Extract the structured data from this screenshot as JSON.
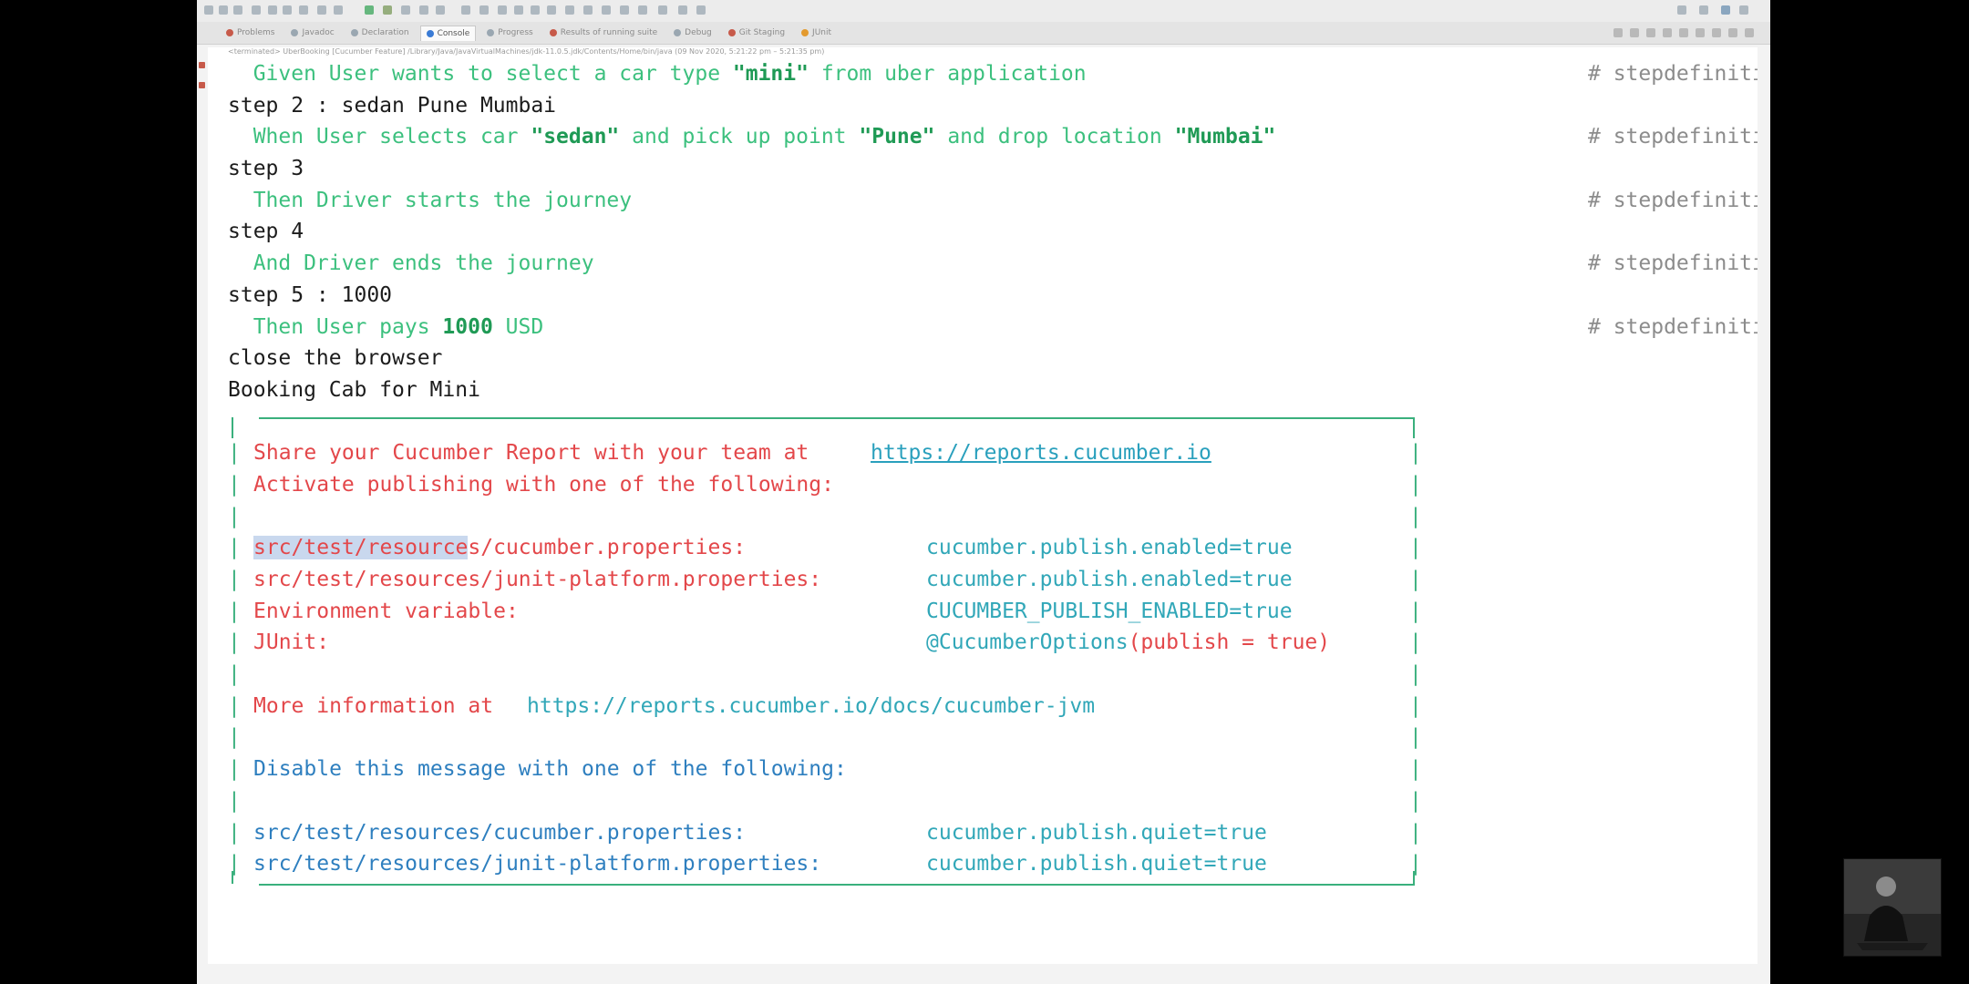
{
  "toolbar": {
    "tabs": [
      {
        "label": "Problems",
        "color": "#c75a4a"
      },
      {
        "label": "Javadoc",
        "color": "#9aa7b1"
      },
      {
        "label": "Declaration",
        "color": "#9aa7b1"
      },
      {
        "label": "Console",
        "color": "#3a7bd5",
        "active": true
      },
      {
        "label": "Progress",
        "color": "#9aa7b1"
      },
      {
        "label": "Results of running suite",
        "color": "#c75a4a"
      },
      {
        "label": "Debug",
        "color": "#9aa7b1"
      },
      {
        "label": "Git Staging",
        "color": "#c75a4a"
      },
      {
        "label": "JUnit",
        "color": "#e39a2e"
      }
    ],
    "console_path": "<terminated> UberBooking [Cucumber Feature] /Library/Java/JavaVirtualMachines/jdk-11.0.5.jdk/Contents/Home/bin/java (09 Nov 2020, 5:21:22 pm – 5:21:35 pm)"
  },
  "console": {
    "steps": {
      "given": {
        "prefix": "  Given User wants to select a car type ",
        "arg": "\"mini\"",
        "suffix": " from uber application"
      },
      "step2": "step 2 : sedan Pune Mumbai",
      "when": {
        "prefix": "  When User selects car ",
        "arg1": "\"sedan\"",
        "mid1": " and pick up point ",
        "arg2": "\"Pune\"",
        "mid2": " and drop location ",
        "arg3": "\"Mumbai\""
      },
      "step3": "step 3",
      "then1": "  Then Driver starts the journey",
      "step4": "step 4",
      "and1": "  And Driver ends the journey",
      "step5": "step 5 : 1000",
      "then2": {
        "prefix": "  Then User pays ",
        "arg": "1000",
        "suffix": " USD"
      },
      "close": "close the browser",
      "booking": "Booking Cab for Mini",
      "step_def_comment": "# stepdefinitions.UberBook"
    },
    "report": {
      "share_text": "Share your Cucumber Report with your team at ",
      "share_link": "https://reports.cucumber.io",
      "activate": "Activate publishing with one of the following:",
      "rows": [
        {
          "key_hl": "src/test/resource",
          "key": "s/cucumber.properties:",
          "value": "cucumber.publish.enabled=true"
        },
        {
          "key_hl": "",
          "key": "src/test/resources/junit-platform.properties:",
          "value": "cucumber.publish.enabled=true"
        },
        {
          "key_hl": "",
          "key": "Environment variable:",
          "value": "CUCUMBER_PUBLISH_ENABLED=true"
        },
        {
          "key_hl": "",
          "key": "JUnit:",
          "value_pre": "@CucumberOptions",
          "value": "(publish = true)"
        }
      ],
      "more_info_text": "More information at ",
      "more_info_link": "https://reports.cucumber.io/docs/cucumber-jvm",
      "disable": "Disable this message with one of the following:",
      "quiet_rows": [
        {
          "key": "src/test/resources/cucumber.properties:",
          "value": "cucumber.publish.quiet=true"
        },
        {
          "key": "src/test/resources/junit-platform.properties:",
          "value": "cucumber.publish.quiet=true"
        }
      ]
    }
  },
  "colors": {
    "step_text": "#3cc07e",
    "report_red": "#e3474a",
    "report_cyan": "#31a7b8",
    "box_green": "#3ab07d"
  }
}
